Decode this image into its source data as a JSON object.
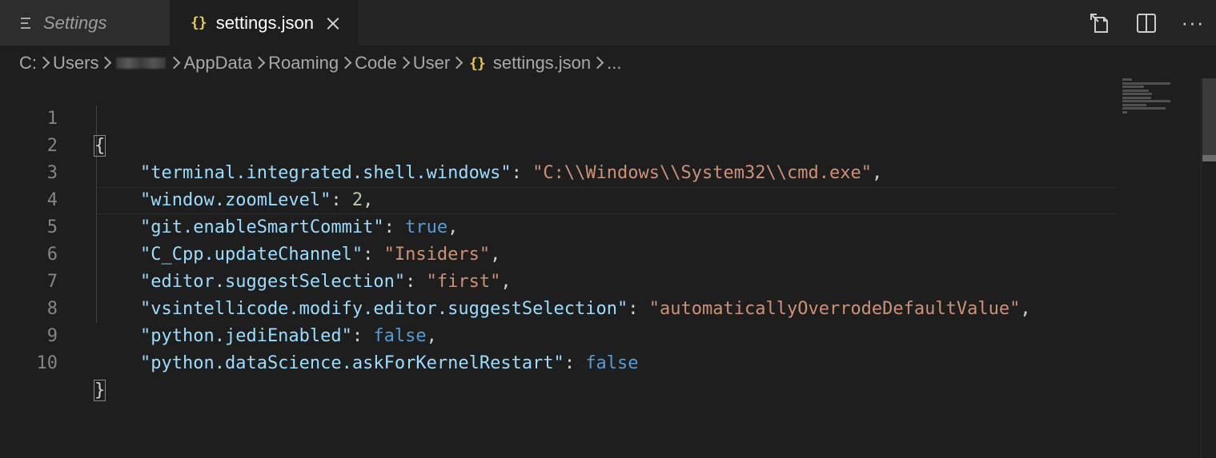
{
  "tabs": [
    {
      "label": "Settings",
      "icon": "settings-lines-icon"
    },
    {
      "label": "settings.json",
      "icon": "json-braces-icon",
      "braces": "{}"
    }
  ],
  "actions": [
    "open-settings-ui-icon",
    "split-editor-icon",
    "more-actions-icon"
  ],
  "actions_more_glyph": "···",
  "breadcrumb": {
    "parts": [
      "C:",
      "Users",
      "AppData",
      "Roaming",
      "Code",
      "User",
      "settings.json",
      "..."
    ],
    "braces": "{}"
  },
  "editor": {
    "line_numbers": [
      "1",
      "2",
      "3",
      "4",
      "5",
      "6",
      "7",
      "8",
      "9",
      "10"
    ],
    "lines": [
      {
        "open": "{"
      },
      {
        "key": "\"terminal.integrated.shell.windows\"",
        "sep": ": ",
        "value": "\"C:\\\\Windows\\\\System32\\\\cmd.exe\"",
        "comma": ","
      },
      {
        "key": "\"window.zoomLevel\"",
        "sep": ": ",
        "value": "2",
        "comma": ","
      },
      {
        "key": "\"git.enableSmartCommit\"",
        "sep": ": ",
        "value": "true",
        "comma": ","
      },
      {
        "key": "\"C_Cpp.updateChannel\"",
        "sep": ": ",
        "value": "\"Insiders\"",
        "comma": ","
      },
      {
        "key": "\"editor.suggestSelection\"",
        "sep": ": ",
        "value": "\"first\"",
        "comma": ","
      },
      {
        "key": "\"vsintellicode.modify.editor.suggestSelection\"",
        "sep": ": ",
        "value": "\"automaticallyOverrodeDefaultValue\"",
        "comma": ","
      },
      {
        "key": "\"python.jediEnabled\"",
        "sep": ": ",
        "value": "false",
        "comma": ","
      },
      {
        "key": "\"python.dataScience.askForKernelRestart\"",
        "sep": ": ",
        "value": "false",
        "comma": ""
      },
      {
        "close": "}"
      }
    ]
  },
  "colors": {
    "key": "#9cdcfe",
    "string": "#ce9178",
    "number": "#b5cea8",
    "keyword": "#569cd6",
    "braces_icon": "#e3c75c"
  }
}
